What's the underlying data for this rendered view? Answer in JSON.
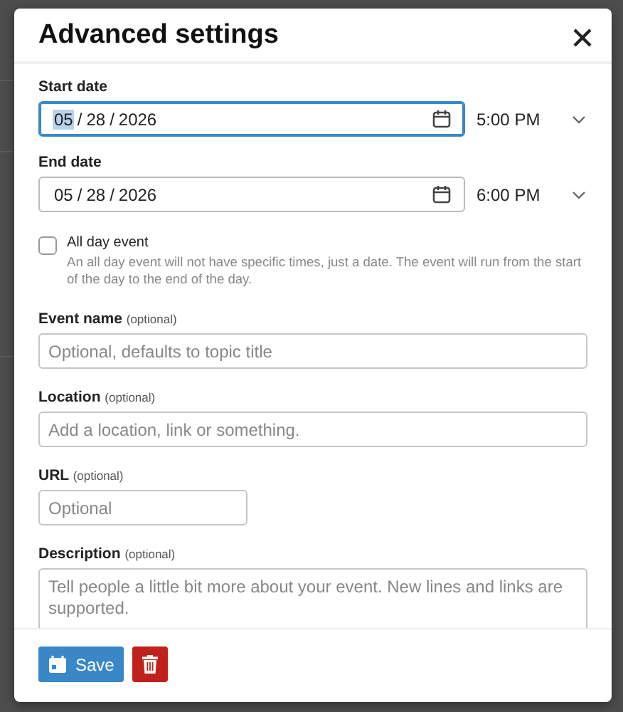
{
  "dialog": {
    "title": "Advanced settings",
    "dates": [
      {
        "label": "Start date",
        "focused": true,
        "separator": "/",
        "segments": [
          {
            "text": "05",
            "selected": true
          },
          {
            "text": "28",
            "selected": false
          },
          {
            "text": "2026",
            "selected": false
          }
        ],
        "time": "5:00 PM"
      },
      {
        "label": "End date",
        "focused": false,
        "separator": "/",
        "segments": [
          {
            "text": "05",
            "selected": false
          },
          {
            "text": "28",
            "selected": false
          },
          {
            "text": "2026",
            "selected": false
          }
        ],
        "time": "6:00 PM"
      }
    ],
    "all_day": {
      "label": "All day event",
      "checked": false,
      "help": "An all day event will not have specific times, just a date. The event will run from the start of the day to the end of the day."
    },
    "fields": [
      {
        "kind": "input",
        "label": "Event name",
        "hint": "(optional)",
        "placeholder": "Optional, defaults to topic title"
      },
      {
        "kind": "input",
        "label": "Location",
        "hint": "(optional)",
        "placeholder": "Add a location, link or something."
      },
      {
        "kind": "short",
        "label": "URL",
        "hint": "(optional)",
        "placeholder": "Optional"
      },
      {
        "kind": "textarea",
        "label": "Description",
        "hint": "(optional)",
        "placeholder": "Tell people a little bit more about your event. New lines and links are supported."
      }
    ],
    "save": {
      "label": "Save"
    }
  }
}
